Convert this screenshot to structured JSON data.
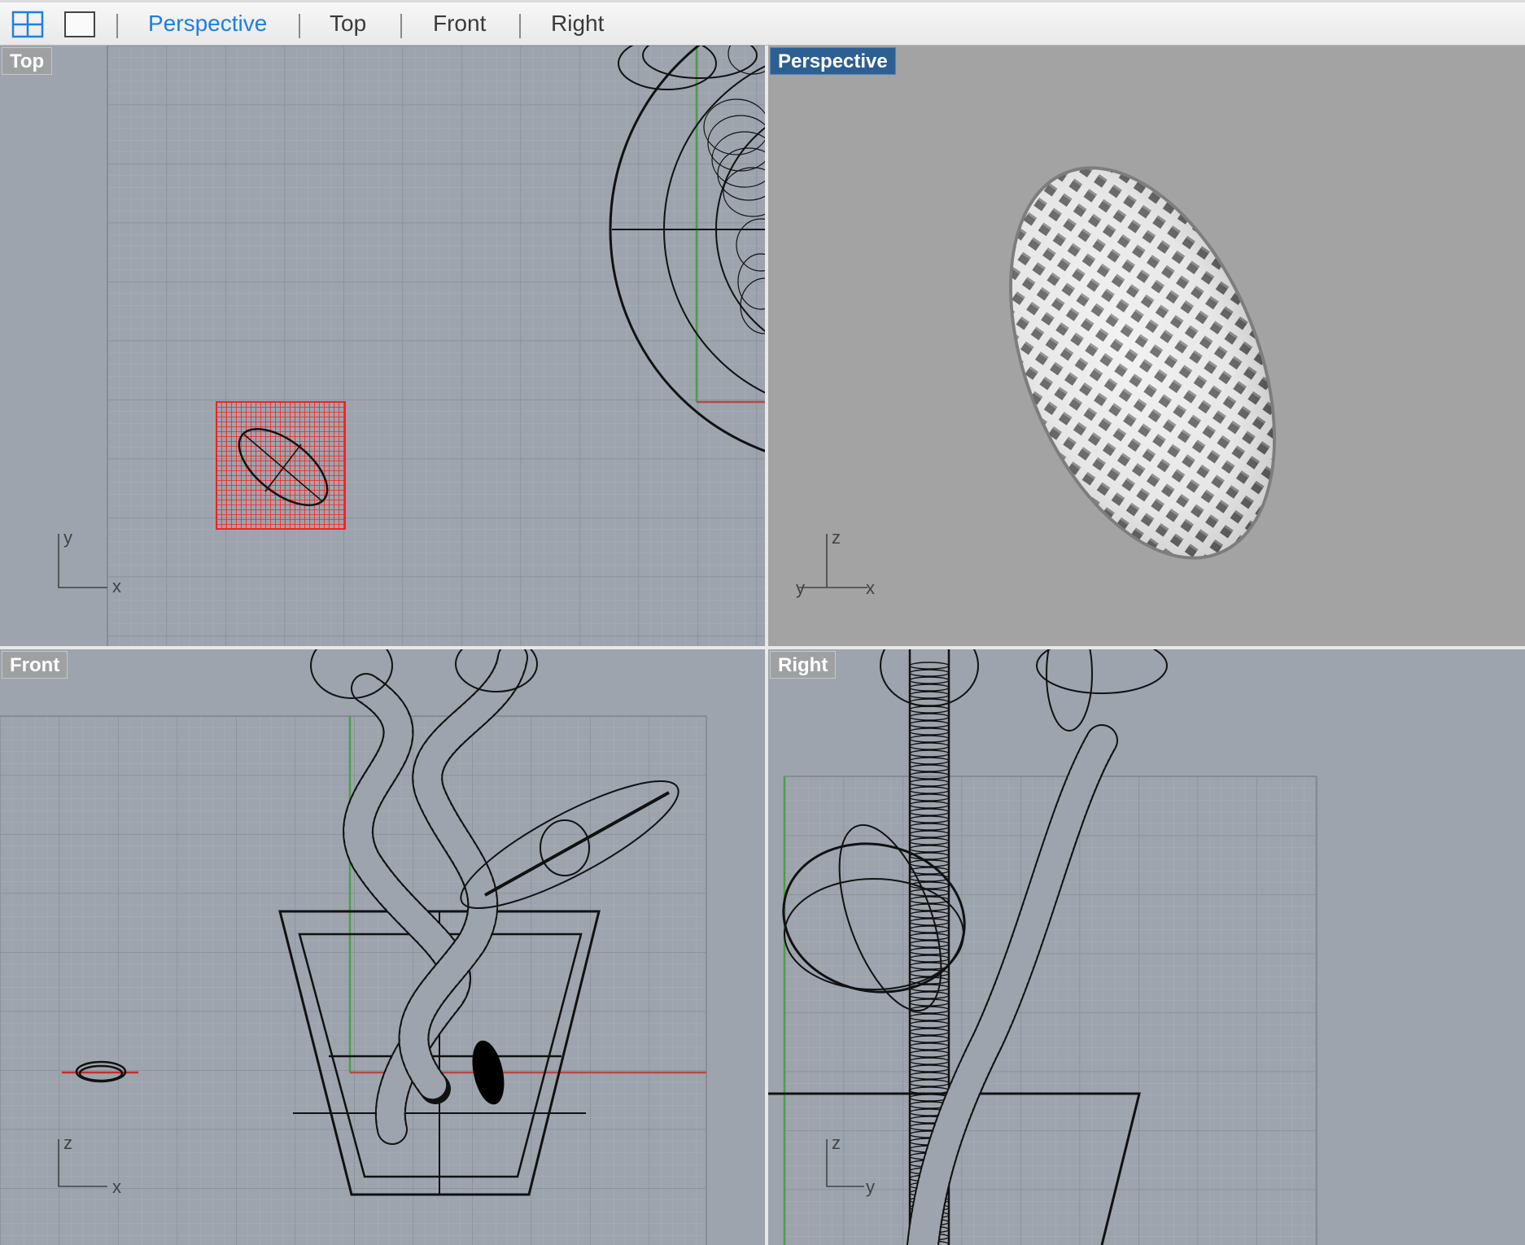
{
  "toolbar": {
    "layout_icons": [
      "four-viewport-layout-icon",
      "single-viewport-layout-icon"
    ],
    "tabs": [
      {
        "label": "Perspective",
        "active": true
      },
      {
        "label": "Top",
        "active": false
      },
      {
        "label": "Front",
        "active": false
      },
      {
        "label": "Right",
        "active": false
      }
    ],
    "active_color": "#1e7fe0"
  },
  "viewports": {
    "top": {
      "label": "Top",
      "axes": [
        "x",
        "y"
      ]
    },
    "perspective": {
      "label": "Perspective",
      "axes": [
        "z",
        "y",
        "x"
      ],
      "active": true
    },
    "front": {
      "label": "Front",
      "axes": [
        "z",
        "x"
      ]
    },
    "right": {
      "label": "Right",
      "axes": [
        "z",
        "y"
      ]
    }
  },
  "colors": {
    "viewport_bg": "#9da4ad",
    "perspective_bg": "#a3a3a3",
    "grid_minor": "#a9b0b8",
    "grid_major": "#8c939b",
    "x_axis": "#b34a47",
    "y_axis": "#4d9e4a",
    "selection": "#ff1e1e",
    "active_label": "#2d5f93"
  }
}
